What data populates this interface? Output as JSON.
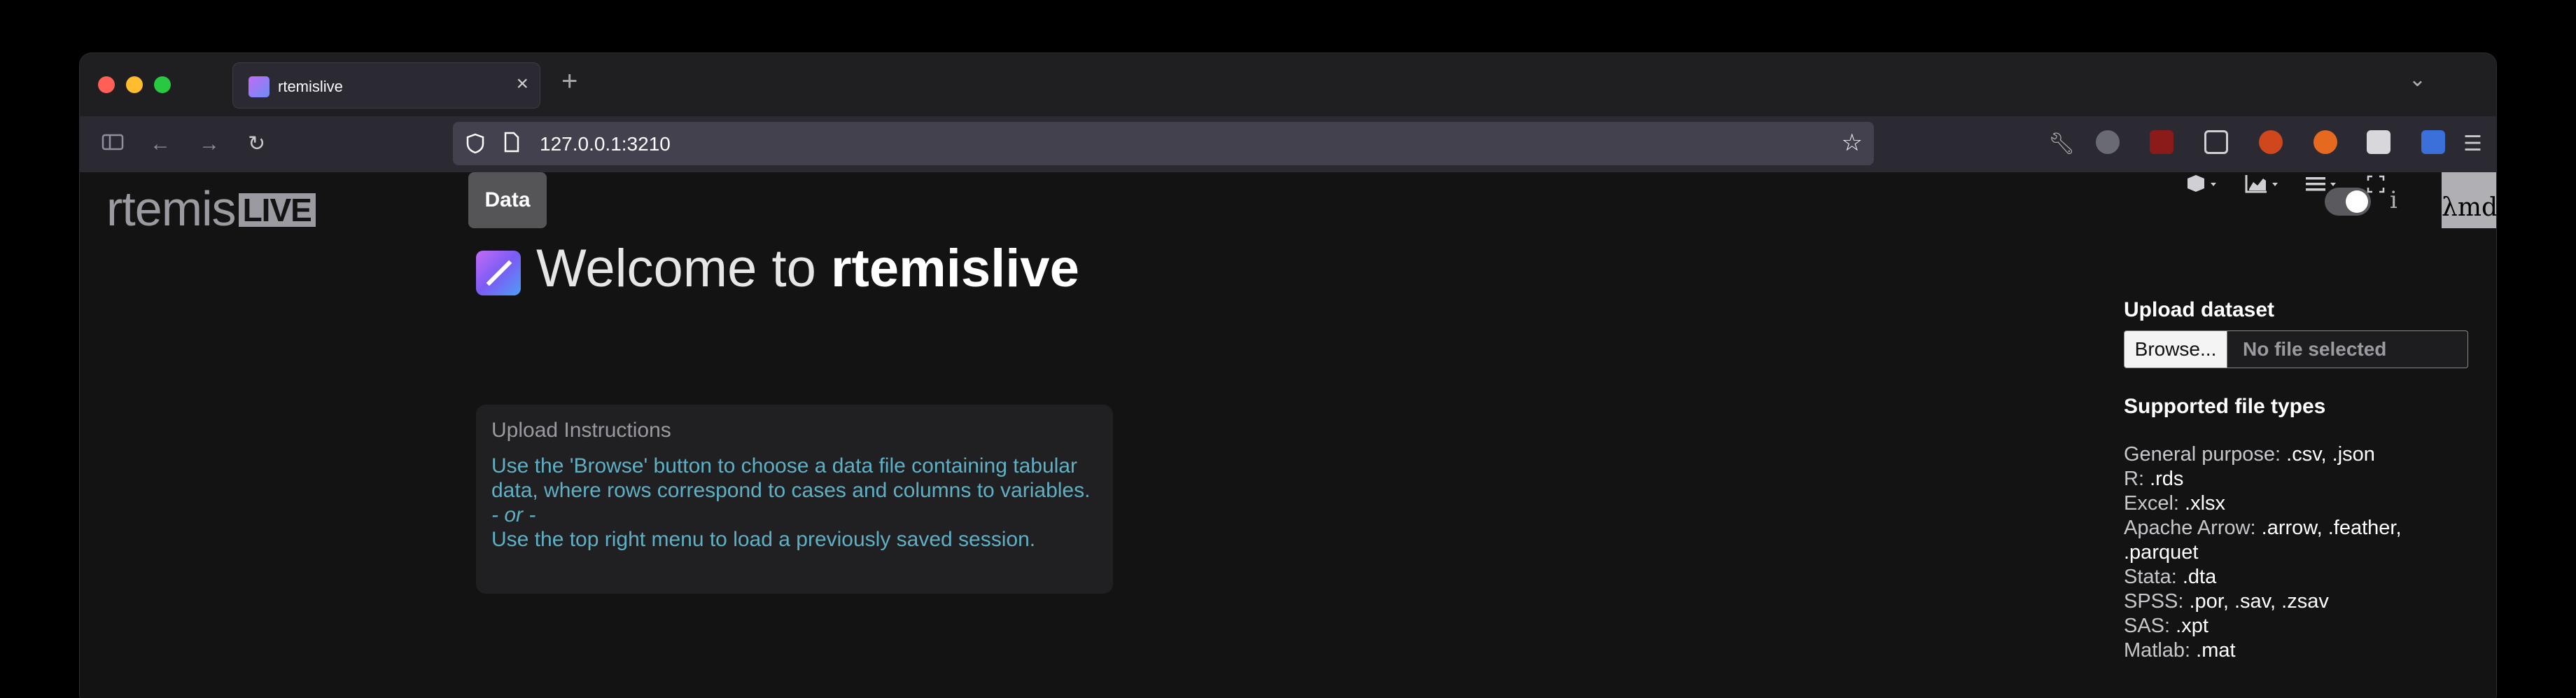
{
  "browser": {
    "tab_title": "rtemislive",
    "url": "127.0.0.1:3210"
  },
  "app": {
    "brand_main": "rtemis",
    "brand_live": "LIVE",
    "nav_tab": "Data",
    "welcome_prefix": "Welcome to ",
    "welcome_name": "rtemislive",
    "corner_text": "λmd",
    "info_icon": "i"
  },
  "instructions": {
    "title": "Upload Instructions",
    "line1": "Use the 'Browse' button to choose a data file containing tabular data, where rows correspond to cases and columns to variables.",
    "or": "- or -",
    "line2": "Use the top right menu to load a previously saved session."
  },
  "upload": {
    "label": "Upload dataset",
    "browse": "Browse...",
    "no_file": "No file selected",
    "types_title": "Supported file types",
    "types": [
      {
        "kind": "General purpose: ",
        "exts": ".csv, .json"
      },
      {
        "kind": "R: ",
        "exts": ".rds"
      },
      {
        "kind": "Excel: ",
        "exts": ".xlsx"
      },
      {
        "kind": "Apache Arrow: ",
        "exts": ".arrow, .feather, .parquet"
      },
      {
        "kind": "Stata: ",
        "exts": ".dta"
      },
      {
        "kind": "SPSS: ",
        "exts": ".por, .sav, .zsav"
      },
      {
        "kind": "SAS: ",
        "exts": ".xpt"
      },
      {
        "kind": "Matlab: ",
        "exts": ".mat"
      }
    ]
  },
  "colors": {
    "accent_instructions": "#5fb0c4",
    "background": "#131314"
  },
  "icons": [
    "sidebar-icon",
    "back-icon",
    "forward-icon",
    "reload-icon",
    "shield-icon",
    "page-icon",
    "star-icon",
    "wrench-icon",
    "cube-icon",
    "chart-icon",
    "menu-icon",
    "fullscreen-icon"
  ]
}
